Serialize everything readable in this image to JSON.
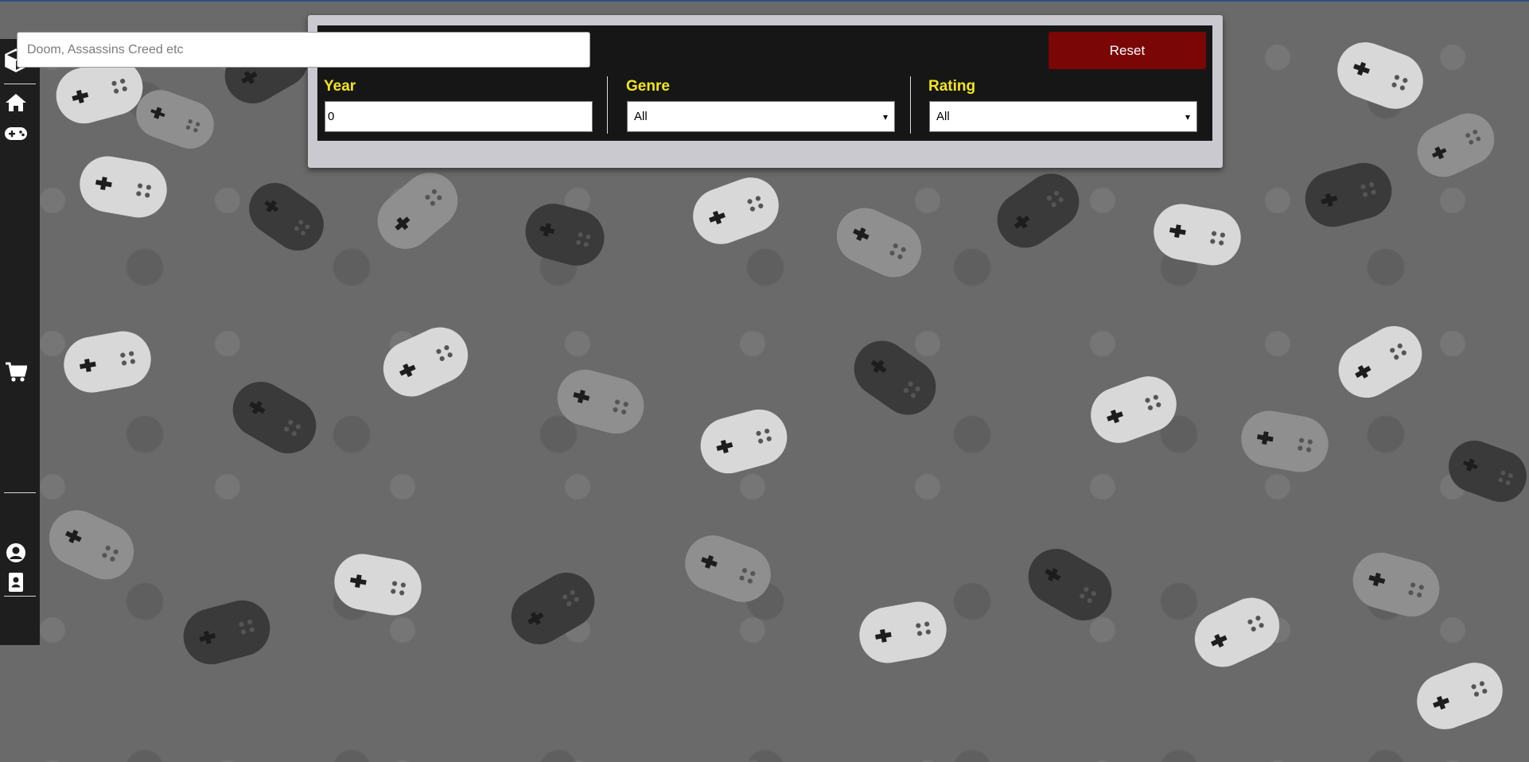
{
  "colors": {
    "sidebar_bg": "#1e1e1e",
    "panel_bg": "#161616",
    "panel_frame": "#c9c9cf",
    "label_color": "#f3e61d",
    "reset_bg": "#7a0606",
    "wallpaper": "#6a6a6a"
  },
  "sidebar": {
    "items": [
      {
        "icon": "cube-icon"
      },
      {
        "icon": "home-icon"
      },
      {
        "icon": "gamepad-icon"
      },
      {
        "icon": "cart-icon"
      },
      {
        "icon": "user-circle-icon"
      },
      {
        "icon": "contact-card-icon"
      }
    ]
  },
  "filters": {
    "search": {
      "placeholder": "Doom, Assassins Creed etc",
      "value": ""
    },
    "reset_label": "Reset",
    "year": {
      "label": "Year",
      "value": "0"
    },
    "genre": {
      "label": "Genre",
      "selected": "All"
    },
    "rating": {
      "label": "Rating",
      "selected": "All"
    }
  }
}
